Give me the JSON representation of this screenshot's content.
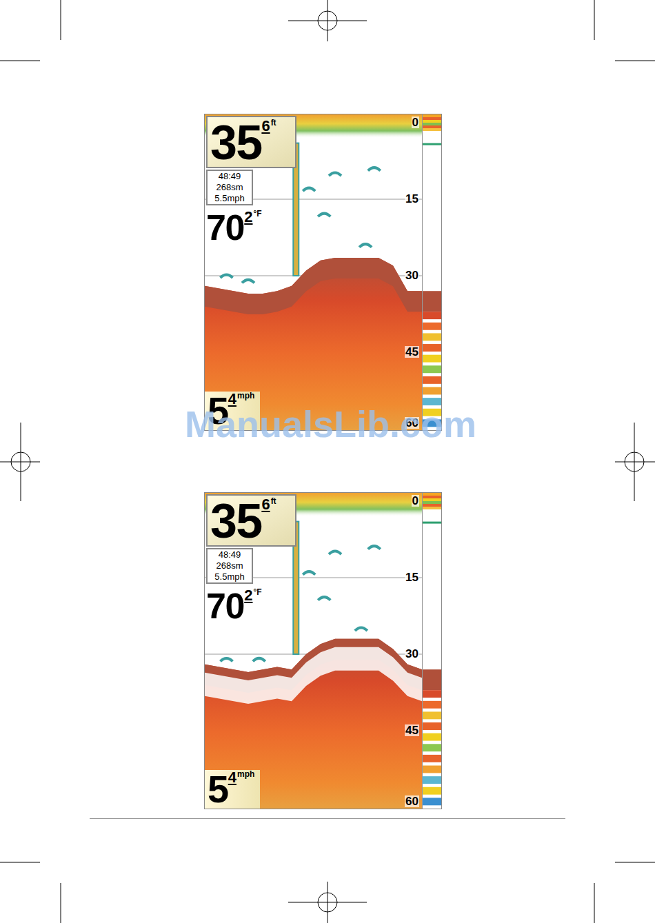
{
  "page": {
    "watermark": "ManualsLib.com"
  },
  "displays": [
    {
      "depth": {
        "whole": "35",
        "tenth": "6",
        "unit": "ft"
      },
      "info": [
        "48:49",
        "268sm",
        "5.5mph"
      ],
      "temperature": {
        "whole": "70",
        "tenth": "2",
        "unit": "°F"
      },
      "speed": {
        "whole": "5",
        "tenth": "4",
        "unit": "mph"
      },
      "scale": [
        "0",
        "15",
        "30",
        "45",
        "60"
      ],
      "whiteline": false,
      "bottom": [
        32,
        32.5,
        33,
        33.5,
        33.5,
        33,
        32,
        29,
        27,
        26.5,
        26.5,
        26.5,
        26.5,
        28,
        33,
        33
      ],
      "targets": [
        {
          "kind": "column",
          "x": 0.42,
          "from": 4,
          "to": 30
        },
        {
          "kind": "arch",
          "x": 0.1,
          "depth": 30
        },
        {
          "kind": "arch",
          "x": 0.2,
          "depth": 31
        },
        {
          "kind": "arch",
          "x": 0.6,
          "depth": 10
        },
        {
          "kind": "arch",
          "x": 0.78,
          "depth": 9
        },
        {
          "kind": "arch",
          "x": 0.55,
          "depth": 18
        },
        {
          "kind": "arch",
          "x": 0.74,
          "depth": 24
        },
        {
          "kind": "arch",
          "x": 0.48,
          "depth": 13
        }
      ]
    },
    {
      "depth": {
        "whole": "35",
        "tenth": "6",
        "unit": "ft"
      },
      "info": [
        "48:49",
        "268sm",
        "5.5mph"
      ],
      "temperature": {
        "whole": "70",
        "tenth": "2",
        "unit": "°F"
      },
      "speed": {
        "whole": "5",
        "tenth": "4",
        "unit": "mph"
      },
      "scale": [
        "0",
        "15",
        "30",
        "45",
        "60"
      ],
      "whiteline": true,
      "bottom": [
        32,
        32.5,
        33,
        33.5,
        33,
        32.5,
        33,
        30,
        28,
        27,
        27,
        27,
        27,
        29,
        32,
        33
      ],
      "targets": [
        {
          "kind": "column",
          "x": 0.42,
          "from": 4,
          "to": 30
        },
        {
          "kind": "arch",
          "x": 0.1,
          "depth": 31
        },
        {
          "kind": "arch",
          "x": 0.25,
          "depth": 31
        },
        {
          "kind": "arch",
          "x": 0.6,
          "depth": 10
        },
        {
          "kind": "arch",
          "x": 0.78,
          "depth": 9
        },
        {
          "kind": "arch",
          "x": 0.55,
          "depth": 19
        },
        {
          "kind": "arch",
          "x": 0.72,
          "depth": 25
        },
        {
          "kind": "arch",
          "x": 0.48,
          "depth": 14
        }
      ]
    }
  ]
}
